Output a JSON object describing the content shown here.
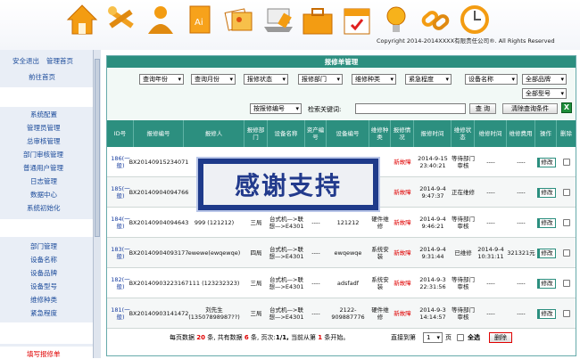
{
  "colors": {
    "accent": "#2c8f7f",
    "link": "#1a4a9a",
    "status_red": "#e00000",
    "overlay_bg": "#1e3a8a"
  },
  "header": {
    "icons": [
      "home-icon",
      "tools-icon",
      "user-icon",
      "document-icon",
      "photos-icon",
      "laptop-icon",
      "briefcase-icon",
      "calendar-icon",
      "lightbulb-icon",
      "link-icon",
      "clock-icon"
    ],
    "copyright": "Copyright 2014-2014XXXX有限责任公司®. All Rights Reserved"
  },
  "sidebar": {
    "top_links": [
      "安全退出",
      "管理首页",
      "前往首页"
    ],
    "group1": [
      "系统配置",
      "管理员管理",
      "总审核管理",
      "部门审核管理",
      "普通用户管理",
      "日志管理",
      "数据中心",
      "系统初始化"
    ],
    "group2": [
      "部门管理",
      "设备名称",
      "设备品牌",
      "设备型号",
      "维修种类",
      "紧急程度"
    ],
    "active": "填写报修单"
  },
  "panel": {
    "title": "报修单管理",
    "filters": {
      "year": "查询年份",
      "month": "查询月份",
      "status": "报修状态",
      "dept": "报修部门",
      "repair_type": "维修种类",
      "urgency": "紧急程度",
      "device_name": "设备名称",
      "brand": "全部品牌",
      "model": "全部型号",
      "repair_no": "按报修编号",
      "keyword_label": "检索关键词:",
      "search_btn": "查 询",
      "clear_btn": "清除查询条件"
    },
    "columns": [
      "ID号",
      "报修编号",
      "报修人",
      "报修部门",
      "设备名称",
      "资产编号",
      "设备编号",
      "维修种类",
      "报修情况",
      "报修时间",
      "维修状态",
      "维修时间",
      "维修费用",
      "操作",
      "删除"
    ],
    "rows": [
      {
        "id": "186(一般)",
        "no": "BX20140915234071",
        "person": "",
        "dept": "",
        "device": "",
        "asset": "",
        "devno": "",
        "type": "",
        "status": "新故障",
        "time": "2014-9-15 23:40:21",
        "rstatus": "等待部门审核",
        "rtime": "----",
        "cost": "----",
        "op": "修改"
      },
      {
        "id": "185(一般)",
        "no": "BX20140904094766",
        "person": "",
        "dept": "",
        "device": "",
        "asset": "",
        "devno": "",
        "type": "",
        "status": "新故障",
        "time": "2014-9-4 9:47:37",
        "rstatus": "正在维修",
        "rtime": "----",
        "cost": "----",
        "op": "修改"
      },
      {
        "id": "184(一般)",
        "no": "BX20140904094643",
        "person": "999 (121212)",
        "dept": "三局",
        "device": "台式机—>联想—>E4301",
        "asset": "----",
        "devno": "121212",
        "type": "硬件维修",
        "status": "新故障",
        "time": "2014-9-4 9:46:21",
        "rstatus": "等待部门审核",
        "rtime": "----",
        "cost": "----",
        "op": "修改"
      },
      {
        "id": "183(一般)",
        "no": "BX20140904093177",
        "person": "ewewe(ewqewqe)",
        "dept": "四局",
        "device": "台式机—>联想—>E4301",
        "asset": "----",
        "devno": "ewqewqe",
        "type": "系统安装",
        "status": "新故障",
        "time": "2014-9-4 9:31:44",
        "rstatus": "已维修",
        "rtime": "2014-9-4 10:31:11",
        "cost": "321321元",
        "op": "修改"
      },
      {
        "id": "182(一般)",
        "no": "BX20140903223167",
        "person": "111 (123232323)",
        "dept": "三局",
        "device": "台式机—>联想—>E4301",
        "asset": "----",
        "devno": "adsfadf",
        "type": "系统安装",
        "status": "新故障",
        "time": "2014-9-3 22:31:56",
        "rstatus": "等待部门审核",
        "rtime": "----",
        "cost": "----",
        "op": "修改"
      },
      {
        "id": "181(一般)",
        "no": "BX20140903141472",
        "person": "刘先生 (13507898987??)",
        "dept": "三局",
        "device": "台式机—>联想—>E4301",
        "asset": "----",
        "devno": "2122-909887776",
        "type": "硬件维修",
        "status": "新故障",
        "time": "2014-9-3 14:14:57",
        "rstatus": "等待部门审核",
        "rtime": "----",
        "cost": "----",
        "op": "修改"
      }
    ],
    "pager": {
      "per_page_label": "每页数据",
      "per_page": "20",
      "unit": "条,",
      "total_label": "共有数据",
      "total": "6",
      "unit2": "条,",
      "page_label": "页次:",
      "page": "1/1,",
      "from_label": "当前从第",
      "from": "1",
      "from_suffix": "条开始。",
      "goto_label": "直接到第",
      "goto": "1",
      "goto_suffix": "页",
      "select_all": "全选",
      "delete": "删除"
    }
  },
  "overlay": {
    "text": "感谢支持"
  }
}
